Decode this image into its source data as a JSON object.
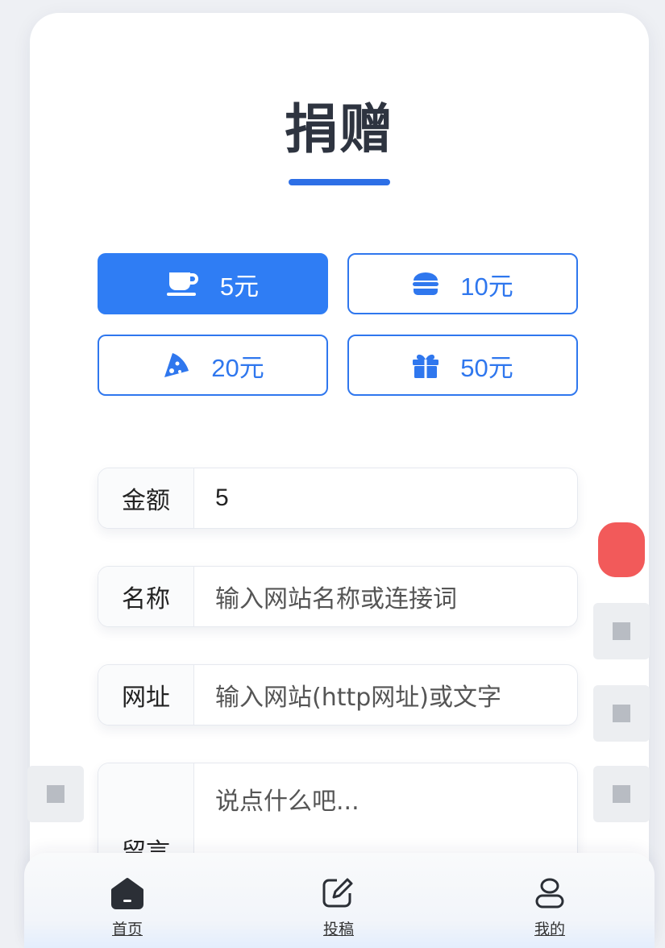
{
  "page": {
    "title": "捐赠"
  },
  "amounts": [
    {
      "label": "5元",
      "icon": "coffee-icon",
      "active": true
    },
    {
      "label": "10元",
      "icon": "burger-icon",
      "active": false
    },
    {
      "label": "20元",
      "icon": "pizza-icon",
      "active": false
    },
    {
      "label": "50元",
      "icon": "gift-icon",
      "active": false
    }
  ],
  "form": {
    "amount": {
      "label": "金额",
      "value": "5"
    },
    "name": {
      "label": "名称",
      "placeholder": "输入网站名称或连接词"
    },
    "url": {
      "label": "网址",
      "placeholder": "输入网站(http网址)或文字"
    },
    "message": {
      "label": "留言",
      "placeholder": "说点什么吧..."
    }
  },
  "nav": {
    "home": "首页",
    "post": "投稿",
    "mine": "我的"
  },
  "colors": {
    "accent": "#2f7df4",
    "title": "#2e3440"
  }
}
